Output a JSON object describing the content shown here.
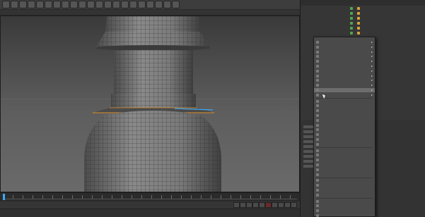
{
  "menubar": {
    "items": [
      "",
      "",
      "",
      "",
      "",
      "",
      "",
      "",
      ""
    ]
  },
  "toolbar": {
    "buttons": [
      {
        "icon": "undo-icon"
      },
      {
        "icon": "redo-icon"
      },
      {
        "icon": "live-selection-icon"
      },
      {
        "icon": "move-icon"
      },
      {
        "icon": "scale-icon"
      },
      {
        "icon": "rotate-icon"
      },
      {
        "icon": "x-axis-icon"
      },
      {
        "icon": "y-axis-icon"
      },
      {
        "icon": "z-axis-icon"
      },
      {
        "icon": "coordinate-system-icon"
      },
      {
        "icon": "render-view-icon"
      },
      {
        "icon": "render-picture-viewer-icon"
      },
      {
        "icon": "render-settings-icon"
      },
      {
        "icon": "cube-icon"
      },
      {
        "icon": "pen-icon"
      },
      {
        "icon": "subdivision-surface-icon"
      },
      {
        "icon": "array-icon"
      },
      {
        "icon": "deformer-icon"
      },
      {
        "icon": "floor-icon"
      },
      {
        "icon": "camera-icon"
      },
      {
        "icon": "light-icon"
      }
    ]
  },
  "viewport": {
    "info": "",
    "colors": {
      "background": "#5a5a5a",
      "object": "#7b7b7b",
      "selection": "#e0902a",
      "highlight": "#3fa9f5"
    }
  },
  "timeline": {
    "current_frame": ""
  },
  "material_bar": {
    "tabs": [
      "",
      "",
      "",
      ""
    ]
  },
  "object_manager": {
    "tabs": [
      "",
      "",
      "",
      ""
    ],
    "objects": [
      "",
      "",
      "",
      "",
      "",
      "",
      ""
    ]
  },
  "context_menu": {
    "items": [
      {
        "label": "",
        "submenu": true
      },
      {
        "label": "",
        "submenu": true
      },
      {
        "label": "",
        "submenu": true
      },
      {
        "label": "",
        "submenu": true
      },
      {
        "label": "",
        "submenu": true
      },
      {
        "label": "",
        "submenu": true
      },
      {
        "label": "",
        "submenu": true
      },
      {
        "label": "",
        "submenu": true
      },
      {
        "label": "",
        "submenu": true
      },
      {
        "label": "",
        "submenu": true
      },
      {
        "label": "",
        "submenu": true,
        "highlighted": true
      },
      {
        "label": "",
        "submenu": true
      },
      {
        "label": "",
        "submenu": false
      },
      {
        "label": "",
        "submenu": false
      },
      {
        "label": "",
        "submenu": false
      },
      {
        "label": "",
        "submenu": false
      },
      {
        "label": "",
        "submenu": false
      },
      {
        "label": "",
        "submenu": false
      },
      {
        "label": "",
        "submenu": false
      },
      {
        "label": "",
        "submenu": false
      },
      {
        "label": "",
        "submenu": false
      },
      {
        "label": "",
        "submenu": false
      },
      {
        "label": "",
        "submenu": false
      },
      {
        "label": "",
        "submenu": false
      },
      {
        "label": "",
        "submenu": false
      },
      {
        "label": "",
        "submenu": false
      },
      {
        "label": "",
        "submenu": false
      },
      {
        "label": "",
        "submenu": false
      },
      {
        "label": "",
        "submenu": false
      },
      {
        "label": "",
        "submenu": false
      },
      {
        "label": "",
        "submenu": false
      },
      {
        "label": "",
        "submenu": false
      },
      {
        "label": "",
        "submenu": false
      },
      {
        "label": "",
        "submenu": false
      },
      {
        "label": "",
        "submenu": false
      },
      {
        "label": "",
        "submenu": false
      }
    ]
  }
}
